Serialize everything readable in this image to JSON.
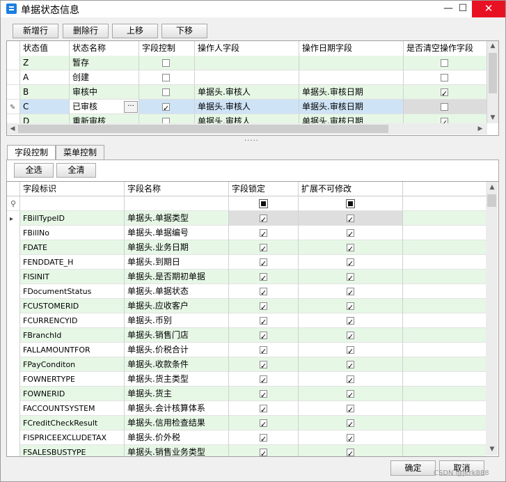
{
  "window": {
    "title": "单据状态信息",
    "minimize": "—",
    "maximize": "☐",
    "close": "✕"
  },
  "toolbar": {
    "add_row": "新增行",
    "delete_row": "删除行",
    "move_up": "上移",
    "move_down": "下移"
  },
  "status_grid": {
    "headers": [
      "状态值",
      "状态名称",
      "字段控制",
      "操作人字段",
      "操作日期字段",
      "是否清空操作字段"
    ],
    "rows": [
      {
        "value": "Z",
        "name": "暂存",
        "field_control": false,
        "operator": "",
        "op_date": "",
        "clear": false,
        "style": "green"
      },
      {
        "value": "A",
        "name": "创建",
        "field_control": false,
        "operator": "",
        "op_date": "",
        "clear": false,
        "style": "white"
      },
      {
        "value": "B",
        "name": "审核中",
        "field_control": false,
        "operator": "单据头.审核人",
        "op_date": "单据头.审核日期",
        "clear": true,
        "style": "green"
      },
      {
        "value": "C",
        "name": "已审核",
        "field_control": true,
        "operator": "单据头.审核人",
        "op_date": "单据头.审核日期",
        "clear": false,
        "style": "selected"
      },
      {
        "value": "D",
        "name": "重新审核",
        "field_control": false,
        "operator": "单据头.审核人",
        "op_date": "单据头.审核日期",
        "clear": true,
        "style": "green"
      }
    ],
    "ellipsis": "···",
    "edit_marker": "✎"
  },
  "tabs": [
    "字段控制",
    "菜单控制"
  ],
  "field_panel": {
    "select_all": "全选",
    "clear_all": "全清",
    "headers": [
      "字段标识",
      "字段名称",
      "字段锁定",
      "扩展不可修改"
    ],
    "filter_marker": "⚲",
    "row_pointer": "▸",
    "rows": [
      {
        "id": "FBillTypeID",
        "name": "单据头.单据类型"
      },
      {
        "id": "FBillNo",
        "name": "单据头.单据编号"
      },
      {
        "id": "FDATE",
        "name": "单据头.业务日期"
      },
      {
        "id": "FENDDATE_H",
        "name": "单据头.到期日"
      },
      {
        "id": "FISINIT",
        "name": "单据头.是否期初单据"
      },
      {
        "id": "FDocumentStatus",
        "name": "单据头.单据状态"
      },
      {
        "id": "FCUSTOMERID",
        "name": "单据头.应收客户"
      },
      {
        "id": "FCURRENCYID",
        "name": "单据头.币别"
      },
      {
        "id": "FBranchId",
        "name": "单据头.销售门店"
      },
      {
        "id": "FALLAMOUNTFOR",
        "name": "单据头.价税合计"
      },
      {
        "id": "FPayConditon",
        "name": "单据头.收款条件"
      },
      {
        "id": "FOWNERTYPE",
        "name": "单据头.货主类型"
      },
      {
        "id": "FOWNERID",
        "name": "单据头.货主"
      },
      {
        "id": "FACCOUNTSYSTEM",
        "name": "单据头.会计核算体系"
      },
      {
        "id": "FCreditCheckResult",
        "name": "单据头.信用检查结果"
      },
      {
        "id": "FISPRICEEXCLUDETAX",
        "name": "单据头.价外税"
      },
      {
        "id": "FSALESBUSTYPE",
        "name": "单据头.销售业务类型"
      }
    ]
  },
  "footer": {
    "ok": "确定",
    "cancel": "取消",
    "watermark": "CSDN @jerk888"
  },
  "colors": {
    "row_green": "#e6f7e6",
    "row_selected": "#cfe3f7",
    "close_red": "#e81123",
    "title_icon": "#1b7fe0"
  }
}
